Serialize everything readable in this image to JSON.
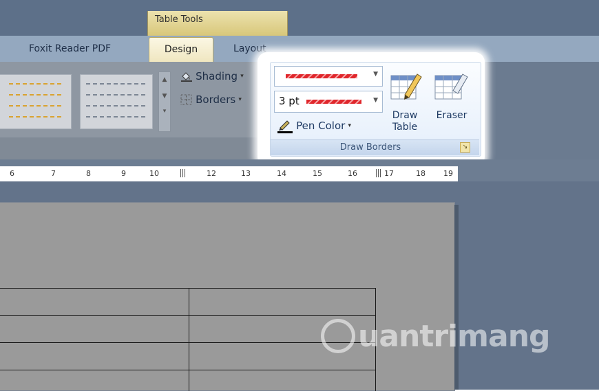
{
  "contextual_tab_group": {
    "label": "Table Tools"
  },
  "tabs": [
    {
      "label": "Foxit Reader PDF"
    },
    {
      "label": "Design"
    },
    {
      "label": "Layout"
    }
  ],
  "table_styles_group": {
    "shading_label": "Shading",
    "borders_label": "Borders"
  },
  "draw_borders": {
    "group_label": "Draw Borders",
    "line_weight_value": "3 pt",
    "pen_color_label": "Pen Color",
    "draw_table_label_1": "Draw",
    "draw_table_label_2": "Table",
    "eraser_label": "Eraser",
    "pen_color": "#e0262b"
  },
  "ruler": {
    "marks": [
      "6",
      "7",
      "8",
      "9",
      "10",
      "12",
      "13",
      "14",
      "15",
      "16",
      "17",
      "18",
      "19"
    ]
  },
  "watermark": {
    "text": "uantrimang"
  }
}
